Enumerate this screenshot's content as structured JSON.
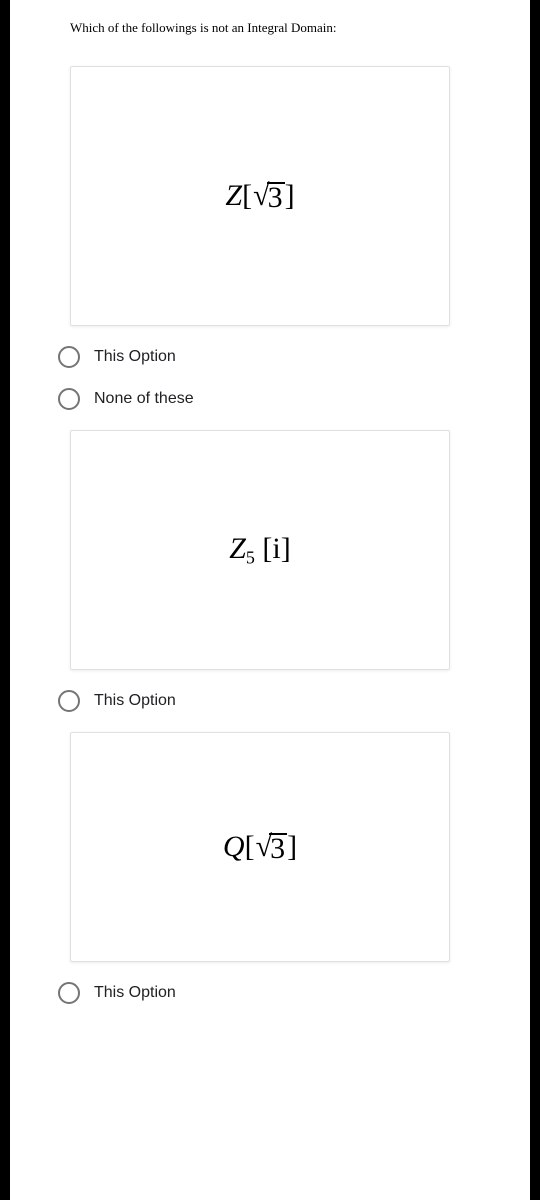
{
  "question": "Which of the followings is not an Integral Domain:",
  "options": {
    "opt1": {
      "expr": {
        "prefix": "Z",
        "hasSqrt": true,
        "sqrtContent": "3",
        "sub": "",
        "bracketContent": ""
      },
      "label": "This Option"
    },
    "opt2": {
      "label": "None of these"
    },
    "opt3": {
      "expr": {
        "prefix": "Z",
        "hasSqrt": false,
        "sub": "5",
        "bracketContent": "i"
      },
      "label": "This Option"
    },
    "opt4": {
      "expr": {
        "prefix": "Q",
        "hasSqrt": true,
        "sqrtContent": "3",
        "sub": "",
        "bracketContent": ""
      },
      "label": "This Option"
    }
  }
}
